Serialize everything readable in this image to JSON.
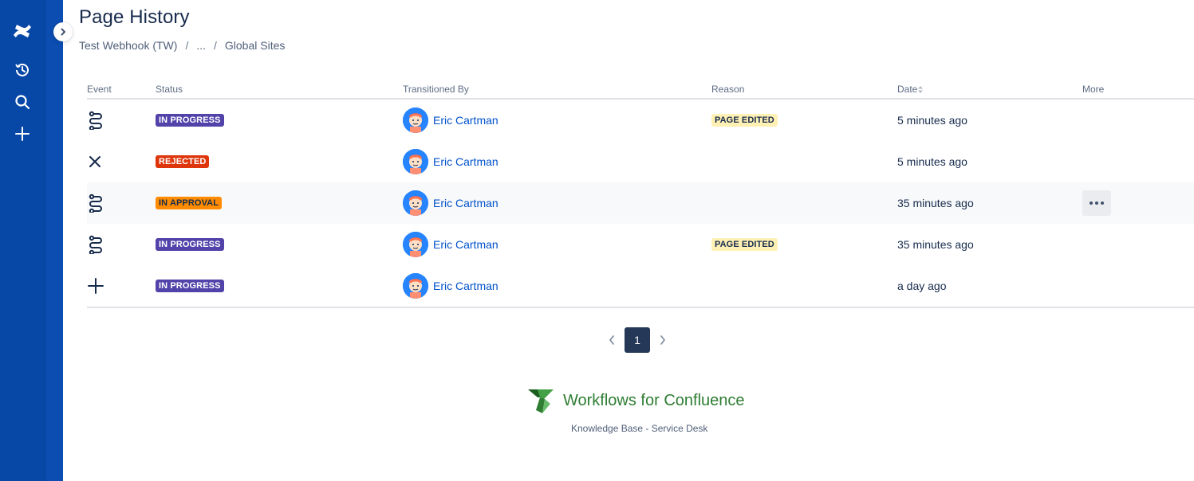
{
  "page": {
    "title": "Page History",
    "breadcrumb": [
      "Test Webhook (TW)",
      "...",
      "Global Sites"
    ],
    "breadcrumb_separator": "/"
  },
  "table": {
    "headers": {
      "event": "Event",
      "status": "Status",
      "transitioned_by": "Transitioned By",
      "reason": "Reason",
      "date": "Date",
      "more": "More"
    },
    "rows": [
      {
        "event_icon": "workflow-icon",
        "status": "IN PROGRESS",
        "status_color": "#5243aa",
        "status_text_color": "#ffffff",
        "user": "Eric Cartman",
        "reason": "PAGE EDITED",
        "date": "5 minutes ago"
      },
      {
        "event_icon": "close-icon",
        "status": "REJECTED",
        "status_color": "#de350b",
        "status_text_color": "#ffffff",
        "user": "Eric Cartman",
        "reason": "",
        "date": "5 minutes ago"
      },
      {
        "event_icon": "workflow-icon",
        "status": "IN APPROVAL",
        "status_color": "#ff8b00",
        "status_text_color": "#172b4d",
        "user": "Eric Cartman",
        "reason": "",
        "date": "35 minutes ago"
      },
      {
        "event_icon": "workflow-icon",
        "status": "IN PROGRESS",
        "status_color": "#5243aa",
        "status_text_color": "#ffffff",
        "user": "Eric Cartman",
        "reason": "PAGE EDITED",
        "date": "35 minutes ago"
      },
      {
        "event_icon": "plus-icon",
        "status": "IN PROGRESS",
        "status_color": "#5243aa",
        "status_text_color": "#ffffff",
        "user": "Eric Cartman",
        "reason": "",
        "date": "a day ago"
      }
    ],
    "reason_color": "#fff0b3",
    "reason_text_color": "#172b4d"
  },
  "pagination": {
    "current": "1"
  },
  "footer": {
    "brand": "Workflows for Confluence",
    "link": "Knowledge Base - Service Desk"
  },
  "colors": {
    "nav": "#0747a6",
    "link": "#0052cc"
  }
}
